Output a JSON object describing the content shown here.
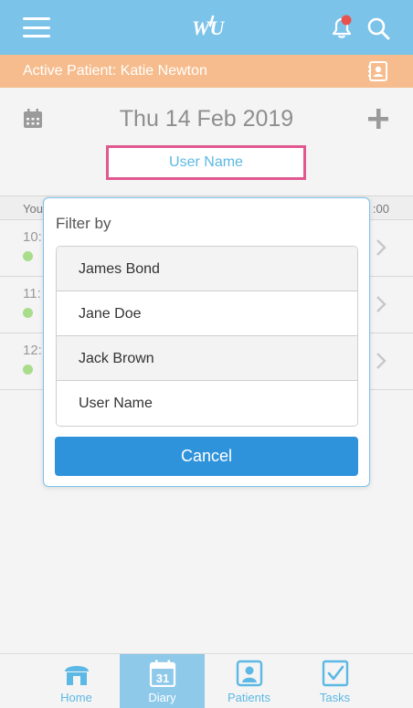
{
  "header": {
    "logo_text": "WU"
  },
  "patient_bar": {
    "label": "Active Patient: Katie Newton"
  },
  "date_bar": {
    "date": "Thu 14 Feb 2019",
    "user_select": "User Name"
  },
  "list": {
    "header_left": "You",
    "header_right": ":00",
    "rows": [
      {
        "time": "10:"
      },
      {
        "time": "11:"
      },
      {
        "time": "12:"
      }
    ]
  },
  "dialog": {
    "title": "Filter by",
    "options": [
      "James Bond",
      "Jane Doe",
      "Jack Brown",
      "User Name"
    ],
    "cancel_label": "Cancel"
  },
  "tabs": [
    {
      "label": "Home",
      "icon": "home-icon"
    },
    {
      "label": "Diary",
      "icon": "calendar-icon",
      "day": "31"
    },
    {
      "label": "Patients",
      "icon": "patient-icon"
    },
    {
      "label": "Tasks",
      "icon": "tasks-icon"
    }
  ],
  "colors": {
    "header": "#7cc3e9",
    "patient_bar": "#f6bc8d",
    "highlight": "#e0588f",
    "primary": "#2f93dc",
    "status_dot": "#a9dd8b",
    "notification": "#e8534f"
  }
}
